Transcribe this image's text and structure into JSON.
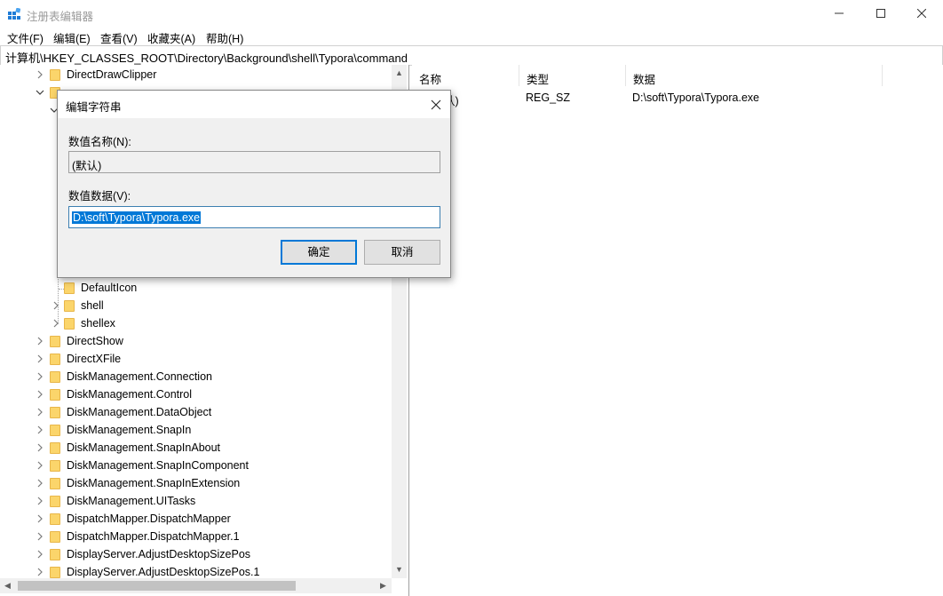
{
  "window": {
    "title": "注册表编辑器"
  },
  "menu": [
    "文件(F)",
    "编辑(E)",
    "查看(V)",
    "收藏夹(A)",
    "帮助(H)"
  ],
  "address": "计算机\\HKEY_CLASSES_ROOT\\Directory\\Background\\shell\\Typora\\command",
  "tree": {
    "top_items": [
      {
        "label": "DirectDrawClipper",
        "expanded": false
      }
    ],
    "sub_items": [
      {
        "label": "DefaultIcon",
        "has_children": false
      },
      {
        "label": "shell",
        "has_children": true
      },
      {
        "label": "shellex",
        "has_children": true
      }
    ],
    "items": [
      {
        "label": "DirectShow",
        "has_children": true
      },
      {
        "label": "DirectXFile",
        "has_children": true
      },
      {
        "label": "DiskManagement.Connection",
        "has_children": true
      },
      {
        "label": "DiskManagement.Control",
        "has_children": true
      },
      {
        "label": "DiskManagement.DataObject",
        "has_children": true
      },
      {
        "label": "DiskManagement.SnapIn",
        "has_children": true
      },
      {
        "label": "DiskManagement.SnapInAbout",
        "has_children": true
      },
      {
        "label": "DiskManagement.SnapInComponent",
        "has_children": true
      },
      {
        "label": "DiskManagement.SnapInExtension",
        "has_children": true
      },
      {
        "label": "DiskManagement.UITasks",
        "has_children": true
      },
      {
        "label": "DispatchMapper.DispatchMapper",
        "has_children": true
      },
      {
        "label": "DispatchMapper.DispatchMapper.1",
        "has_children": true
      },
      {
        "label": "DisplayServer.AdjustDesktopSizePos",
        "has_children": true
      },
      {
        "label": "DisplayServer.AdjustDesktopSizePos.1",
        "has_children": true
      }
    ]
  },
  "values": {
    "headers": [
      "名称",
      "类型",
      "数据"
    ],
    "rows": [
      {
        "name": "认)",
        "type": "REG_SZ",
        "data": "D:\\soft\\Typora\\Typora.exe"
      }
    ]
  },
  "dialog": {
    "title": "编辑字符串",
    "name_label": "数值名称(N):",
    "name_value": "(默认)",
    "data_label": "数值数据(V):",
    "data_value": "D:\\soft\\Typora\\Typora.exe",
    "ok_label": "确定",
    "cancel_label": "取消"
  },
  "colors": {
    "accent": "#0078d7",
    "folder": "#fbd56b",
    "dialog_bg": "#f0f0f0"
  }
}
